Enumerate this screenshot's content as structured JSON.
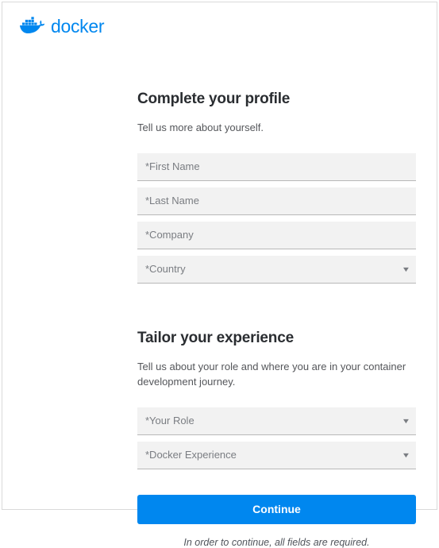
{
  "logo": {
    "text": "docker"
  },
  "section1": {
    "title": "Complete your profile",
    "subtitle": "Tell us more about yourself.",
    "fields": {
      "first_name": "*First Name",
      "last_name": "*Last Name",
      "company": "*Company",
      "country": "*Country"
    }
  },
  "section2": {
    "title": "Tailor your experience",
    "subtitle": "Tell us about your role and where you are in your container development journey.",
    "fields": {
      "role": "*Your Role",
      "experience": "*Docker Experience"
    }
  },
  "cta": {
    "continue": "Continue"
  },
  "required_note": "In order to continue, all fields are required."
}
